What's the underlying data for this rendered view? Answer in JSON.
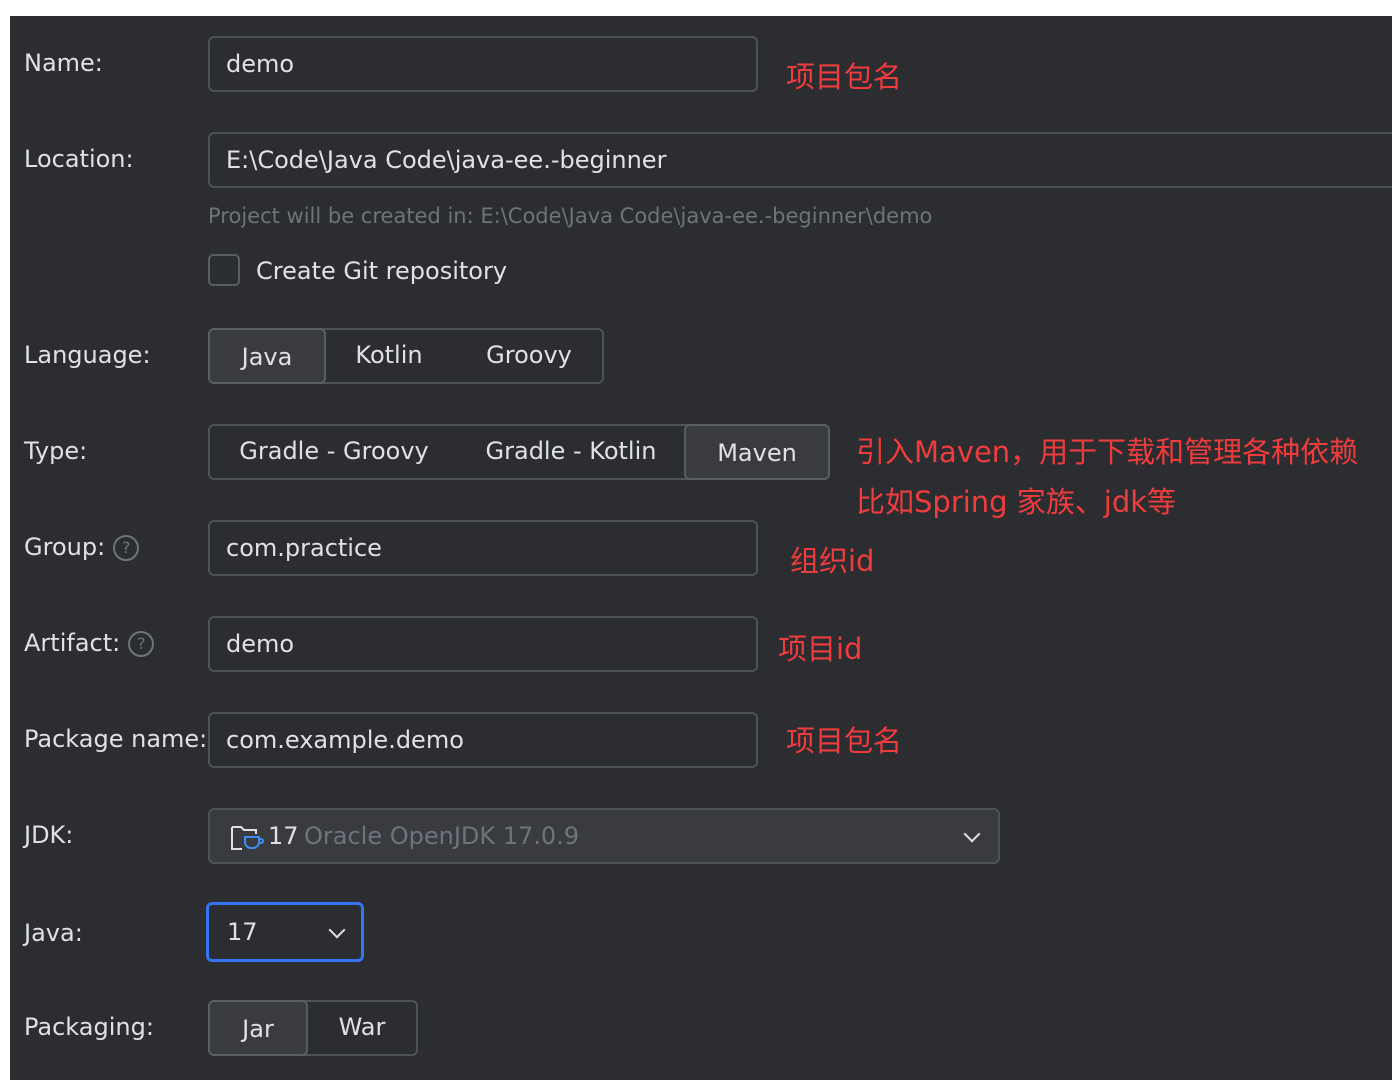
{
  "form": {
    "name": {
      "label": "Name:",
      "value": "demo"
    },
    "location": {
      "label": "Location:",
      "value": "E:\\Code\\Java Code\\java-ee.-beginner",
      "hint": "Project will be created in: E:\\Code\\Java Code\\java-ee.-beginner\\demo"
    },
    "git": {
      "label": "Create Git repository",
      "checked": false
    },
    "language": {
      "label": "Language:",
      "options": [
        "Java",
        "Kotlin",
        "Groovy"
      ],
      "selected": "Java"
    },
    "type": {
      "label": "Type:",
      "options": [
        "Gradle - Groovy",
        "Gradle - Kotlin",
        "Maven"
      ],
      "selected": "Maven"
    },
    "group": {
      "label": "Group:",
      "value": "com.practice"
    },
    "artifact": {
      "label": "Artifact:",
      "value": "demo"
    },
    "package_name": {
      "label": "Package name:",
      "value": "com.example.demo"
    },
    "jdk": {
      "label": "JDK:",
      "version": "17",
      "detail": "Oracle OpenJDK 17.0.9"
    },
    "java": {
      "label": "Java:",
      "value": "17"
    },
    "packaging": {
      "label": "Packaging:",
      "options": [
        "Jar",
        "War"
      ],
      "selected": "Jar"
    },
    "help_glyph": "?"
  },
  "annotations": {
    "name_note": "项目包名",
    "type_note_line1": "引入Maven，用于下载和管理各种依赖",
    "type_note_line2": "比如Spring 家族、jdk等",
    "group_note": "组织id",
    "artifact_note": "项目id",
    "package_note": "项目包名"
  },
  "colors": {
    "panel_bg": "#2b2d30",
    "text": "#dfe1e5",
    "muted": "#6f737a",
    "border": "#4e5157",
    "focus": "#3574f0",
    "annotation": "#f03c3c"
  },
  "icons": {
    "jdk": "folder-cup-icon",
    "dropdown": "chevron-down-icon",
    "help": "question-circle-icon"
  }
}
